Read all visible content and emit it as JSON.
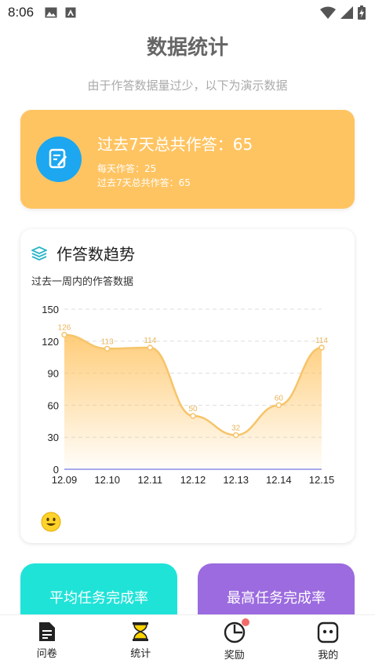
{
  "status": {
    "time": "8:06"
  },
  "header": {
    "title": "数据统计",
    "subtitle": "由于作答数据量过少，以下为演示数据"
  },
  "summary": {
    "main": "过去7天总共作答：65",
    "daily": "每天作答：25",
    "week": "过去7天总共作答：65"
  },
  "trend": {
    "title": "作答数趋势",
    "description": "过去一周内的作答数据"
  },
  "chart_data": {
    "type": "area",
    "categories": [
      "12.09",
      "12.10",
      "12.11",
      "12.12",
      "12.13",
      "12.14",
      "12.15"
    ],
    "values": [
      126,
      113,
      114,
      50,
      32,
      60,
      114
    ],
    "yticks": [
      0,
      30,
      60,
      90,
      120,
      150
    ],
    "ylim": [
      0,
      150
    ],
    "grid": true,
    "line_color": "#F6C46A",
    "fill_color": "#FFC462",
    "axis_color": "#8C8CE8"
  },
  "rate_cards": [
    {
      "label": "平均任务完成率",
      "color": "#20E3D8"
    },
    {
      "label": "最高任务完成率",
      "color": "#9B6BDF"
    }
  ],
  "nav": [
    {
      "label": "问卷",
      "icon": "document-icon"
    },
    {
      "label": "统计",
      "icon": "hourglass-icon"
    },
    {
      "label": "奖励",
      "icon": "pie-chart-icon"
    },
    {
      "label": "我的",
      "icon": "face-icon"
    }
  ]
}
